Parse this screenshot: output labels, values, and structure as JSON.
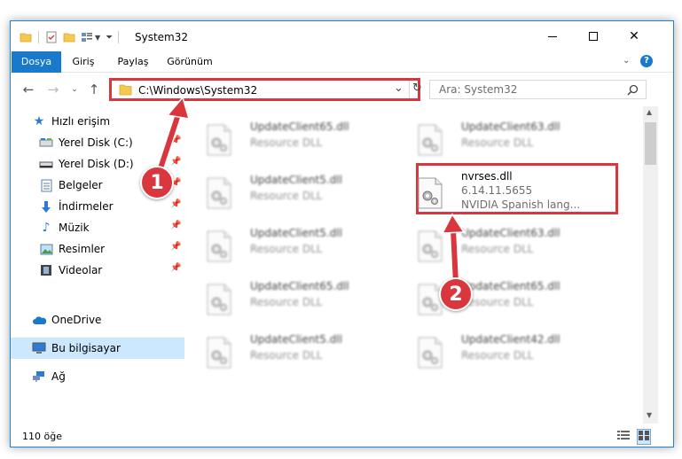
{
  "window": {
    "title": "System32"
  },
  "ribbon": {
    "tabs": [
      "Dosya",
      "Giriş",
      "Paylaş",
      "Görünüm"
    ]
  },
  "address": {
    "path": "C:\\Windows\\System32"
  },
  "search": {
    "placeholder": "Ara: System32"
  },
  "nav_pane": {
    "items": [
      {
        "label": "Hızlı erişim",
        "icon": "star-icon"
      },
      {
        "label": "Yerel Disk (C:)",
        "icon": "drive-icon"
      },
      {
        "label": "Yerel Disk (D:)",
        "icon": "drive-icon"
      },
      {
        "label": "Belgeler",
        "icon": "documents-icon"
      },
      {
        "label": "İndirmeler",
        "icon": "download-icon"
      },
      {
        "label": "Müzik",
        "icon": "music-icon"
      },
      {
        "label": "Resimler",
        "icon": "pictures-icon"
      },
      {
        "label": "Videolar",
        "icon": "videos-icon"
      },
      {
        "label": "OneDrive",
        "icon": "cloud-icon"
      },
      {
        "label": "Bu bilgisayar",
        "icon": "computer-icon"
      },
      {
        "label": "Ağ",
        "icon": "network-icon"
      }
    ]
  },
  "files": [
    {
      "name": "UpdateClient65.dll",
      "line2": "Resource DLL",
      "line3": ""
    },
    {
      "name": "UpdateClient63.dll",
      "line2": "Resource DLL",
      "line3": ""
    },
    {
      "name": "UpdateClient5.dll",
      "line2": "Resource DLL",
      "line3": ""
    },
    {
      "name": "nvrses.dll",
      "line2": "6.14.11.5655",
      "line3": "NVIDIA Spanish lang..."
    },
    {
      "name": "UpdateClient5.dll",
      "line2": "Resource DLL",
      "line3": ""
    },
    {
      "name": "UpdateClient63.dll",
      "line2": "Resource DLL",
      "line3": ""
    },
    {
      "name": "UpdateClient65.dll",
      "line2": "Resource DLL",
      "line3": ""
    },
    {
      "name": "UpdateClient65.dll",
      "line2": "Resource DLL",
      "line3": ""
    },
    {
      "name": "UpdateClient5.dll",
      "line2": "Resource DLL",
      "line3": ""
    },
    {
      "name": "UpdateClient42.dll",
      "line2": "Resource DLL",
      "line3": ""
    }
  ],
  "status": {
    "item_count": "110 öğe"
  },
  "annotations": {
    "step1": "1",
    "step2": "2"
  },
  "colors": {
    "accent": "#1979ca",
    "highlight": "#d9363e",
    "selection": "#cce8ff"
  }
}
